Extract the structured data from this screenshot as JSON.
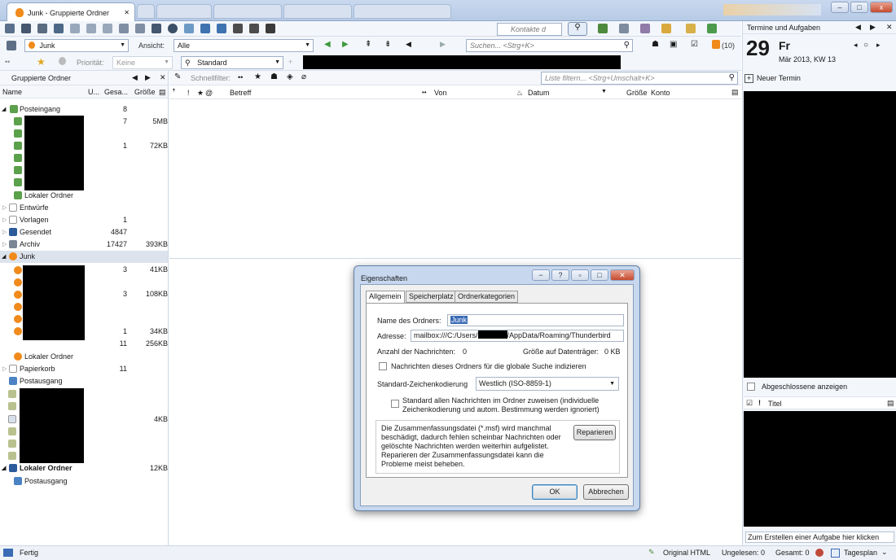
{
  "window": {
    "tab_title": "Junk - Gruppierte Ordner",
    "controls": {
      "minimize": "–",
      "maximize": "□",
      "close": "x"
    }
  },
  "toolbar": {
    "folder_combo": "Junk",
    "view_label": "Ansicht:",
    "view_combo": "Alle",
    "contacts_placeholder": "Kontakte d",
    "search_placeholder": "Suchen... <Strg+K>",
    "rss_count": "(10)",
    "priority_label": "Priorität:",
    "priority_combo": "Keine",
    "style_combo": "Standard"
  },
  "folder_pane": {
    "title": "Gruppierte Ordner",
    "columns": {
      "name": "Name",
      "unread": "U...",
      "total": "Gesa...",
      "size": "Größe"
    },
    "rows": [
      {
        "name": "Posteingang",
        "total": "8",
        "size": ""
      },
      {
        "name": "",
        "total": "7",
        "size": "5MB"
      },
      {
        "name": "",
        "total": "1",
        "size": "72KB"
      },
      {
        "name": "Lokaler Ordner",
        "total": "",
        "size": ""
      },
      {
        "name": "Entwürfe",
        "total": "",
        "size": ""
      },
      {
        "name": "Vorlagen",
        "total": "1",
        "size": ""
      },
      {
        "name": "Gesendet",
        "total": "4847",
        "size": ""
      },
      {
        "name": "Archiv",
        "total": "17427",
        "size": "393KB"
      },
      {
        "name": "Junk",
        "total": "",
        "size": ""
      },
      {
        "name": "",
        "total": "3",
        "size": "41KB"
      },
      {
        "name": "",
        "total": "3",
        "size": "108KB"
      },
      {
        "name": "",
        "total": "1",
        "size": "34KB"
      },
      {
        "name": "",
        "total": "11",
        "size": "256KB"
      },
      {
        "name": "Lokaler Ordner",
        "total": "",
        "size": ""
      },
      {
        "name": "Papierkorb",
        "total": "11",
        "size": ""
      },
      {
        "name": "Postausgang",
        "total": "",
        "size": ""
      },
      {
        "name": "",
        "total": "",
        "size": "4KB"
      },
      {
        "name": "Lokaler Ordner",
        "total": "",
        "size": "12KB"
      },
      {
        "name": "Postausgang",
        "total": "",
        "size": ""
      }
    ]
  },
  "message_list": {
    "quickfilter_label": "Schnellfilter:",
    "filter_placeholder": "Liste filtern... <Strg+Umschalt+K>",
    "columns": {
      "subject": "Betreff",
      "from": "Von",
      "date": "Datum",
      "size": "Größe",
      "account": "Konto"
    }
  },
  "calendar": {
    "title": "Termine und Aufgaben",
    "day_number": "29",
    "weekday": "Fr",
    "month_week": "Mär 2013, KW 13",
    "new_event": "Neuer Termin",
    "show_completed": "Abgeschlossene anzeigen",
    "task_title_col": "Titel",
    "new_task_placeholder": "Zum Erstellen einer Aufgabe hier klicken"
  },
  "dialog": {
    "title": "Eigenschaften",
    "tabs": [
      "Allgemein",
      "Speicherplatz",
      "Ordnerkategorien"
    ],
    "name_label": "Name des Ordners:",
    "name_value": "Junk",
    "address_label": "Adresse:",
    "address_prefix": "mailbox:///C:/Users/",
    "address_suffix": "/AppData/Roaming/Thunderbird",
    "count_label": "Anzahl der Nachrichten:",
    "count_value": "0",
    "disk_label": "Größe auf Datenträger:",
    "disk_value": "0 KB",
    "index_checkbox": "Nachrichten dieses Ordners für die globale Suche indizieren",
    "encoding_label": "Standard-Zeichenkodierung",
    "encoding_value": "Westlich (ISO-8859-1)",
    "force_checkbox_line1": "Standard allen Nachrichten im Ordner zuweisen (individuelle",
    "force_checkbox_line2": "Zeichenkodierung und autom. Bestimmung werden ignoriert)",
    "repair_text": "Die Zusammenfassungsdatei (*.msf) wird manchmal beschädigt, dadurch fehlen scheinbar Nachrichten oder gelöschte Nachrichten werden weiterhin aufgelistet. Reparieren der Zusammenfassungsdatei kann die Probleme meist beheben.",
    "repair_button": "Reparieren",
    "ok_button": "OK",
    "cancel_button": "Abbrechen"
  },
  "status": {
    "text": "Fertig",
    "html_mode": "Original HTML",
    "unread": "Ungelesen: 0",
    "total": "Gesamt: 0",
    "calendar_mode": "Tagesplan"
  },
  "colors": {
    "accent": "#3a6bb5",
    "selection": "#dde3ec",
    "tab_bg": "#c9d8ee"
  }
}
